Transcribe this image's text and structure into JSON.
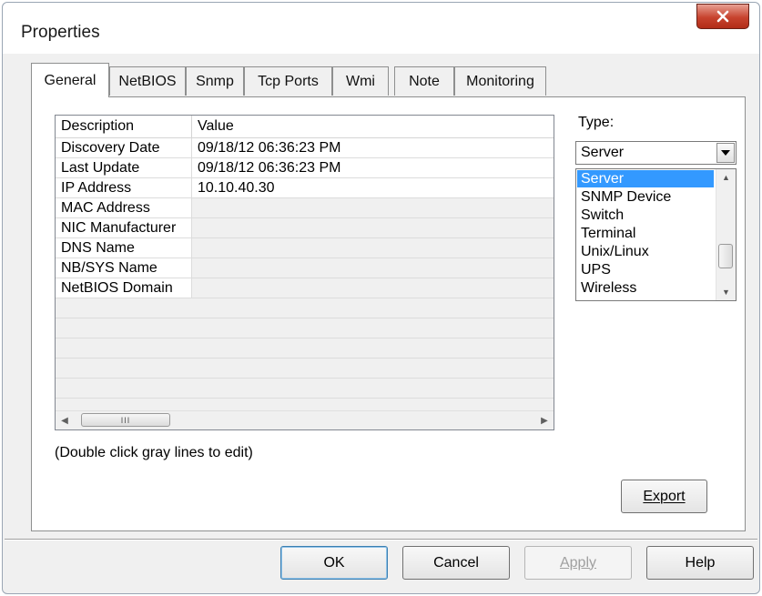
{
  "window": {
    "title": "Properties",
    "close_label": "X"
  },
  "tabs": [
    {
      "label": "General",
      "active": true
    },
    {
      "label": "NetBIOS",
      "active": false
    },
    {
      "label": "Snmp",
      "active": false
    },
    {
      "label": "Tcp Ports",
      "active": false
    },
    {
      "label": "Wmi",
      "active": false
    },
    {
      "label": "Note",
      "active": false
    },
    {
      "label": "Monitoring",
      "active": false
    }
  ],
  "table": {
    "columns": [
      "Description",
      "Value"
    ],
    "rows": [
      {
        "description": "Discovery Date",
        "value": "09/18/12 06:36:23 PM"
      },
      {
        "description": "Last Update",
        "value": "09/18/12 06:36:23 PM"
      },
      {
        "description": "IP Address",
        "value": "10.10.40.30"
      },
      {
        "description": "MAC Address",
        "value": ""
      },
      {
        "description": "NIC Manufacturer",
        "value": ""
      },
      {
        "description": "DNS Name",
        "value": ""
      },
      {
        "description": "NB/SYS Name",
        "value": ""
      },
      {
        "description": "NetBIOS Domain",
        "value": ""
      }
    ],
    "scroll_thumb_glyph": "III"
  },
  "type": {
    "label": "Type:",
    "selected": "Server",
    "options": [
      "Server",
      "SNMP Device",
      "Switch",
      "Terminal",
      "Unix/Linux",
      "UPS",
      "Wireless"
    ]
  },
  "hint": "(Double click gray lines to edit)",
  "buttons": {
    "export": "Export",
    "ok": "OK",
    "cancel": "Cancel",
    "apply": "Apply",
    "help": "Help"
  },
  "colors": {
    "selection": "#3399ff",
    "close_button": "#c7432e",
    "dialog_background": "#f0f0f0"
  }
}
